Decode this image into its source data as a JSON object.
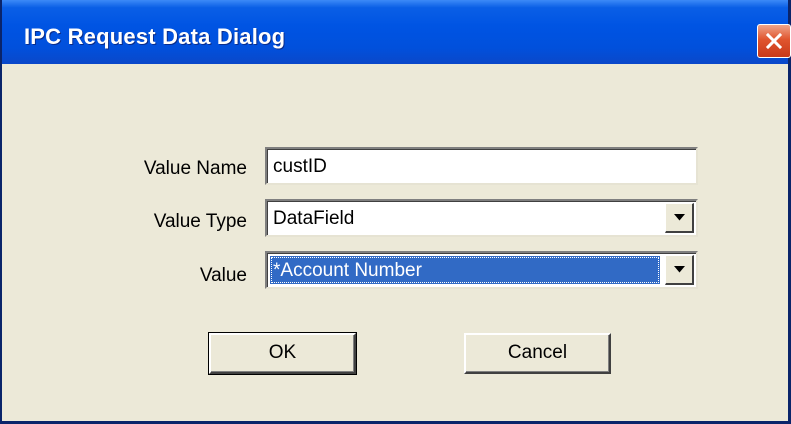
{
  "dialog": {
    "title": "IPC Request Data Dialog"
  },
  "form": {
    "value_name": {
      "label": "Value Name",
      "value": "custID"
    },
    "value_type": {
      "label": "Value Type",
      "selected": "DataField"
    },
    "value": {
      "label": "Value",
      "selected": "*Account Number"
    }
  },
  "buttons": {
    "ok_label": "OK",
    "cancel_label": "Cancel"
  },
  "icons": {
    "close": "close-icon",
    "dropdown": "chevron-down-icon"
  },
  "colors": {
    "title_bar": "#0054E3",
    "dialog_face": "#ECE9D8",
    "close_button": "#E0552E",
    "selection_highlight": "#316AC5"
  }
}
